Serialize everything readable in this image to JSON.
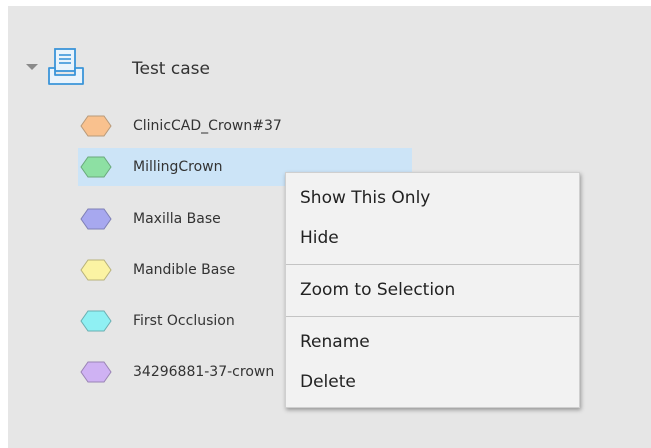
{
  "tree": {
    "root": {
      "label": "Test case",
      "icon": "case-tray-icon",
      "expanded": true
    },
    "items": [
      {
        "label": "ClinicCAD_Crown#37",
        "icon": "hexagon-icon",
        "color": "#f9c18e",
        "selected": false
      },
      {
        "label": "MillingCrown",
        "icon": "hexagon-icon",
        "color": "#8de0a3",
        "selected": true
      },
      {
        "label": "Maxilla Base",
        "icon": "hexagon-icon",
        "color": "#a7a8ef",
        "selected": false
      },
      {
        "label": "Mandible Base",
        "icon": "hexagon-icon",
        "color": "#fbf3a3",
        "selected": false
      },
      {
        "label": "First Occlusion",
        "icon": "hexagon-icon",
        "color": "#8ff0f3",
        "selected": false
      },
      {
        "label": "34296881-37-crown",
        "icon": "hexagon-icon",
        "color": "#cfb2f3",
        "selected": false
      }
    ]
  },
  "context_menu": {
    "show_this_only": "Show This Only",
    "hide": "Hide",
    "zoom_to_selection": "Zoom to Selection",
    "rename": "Rename",
    "delete": "Delete"
  },
  "colors": {
    "panel_bg": "#e6e6e6",
    "selection_bg": "#cce4f7",
    "menu_bg": "#f2f2f2",
    "icon_blue": "#3b95d9"
  }
}
